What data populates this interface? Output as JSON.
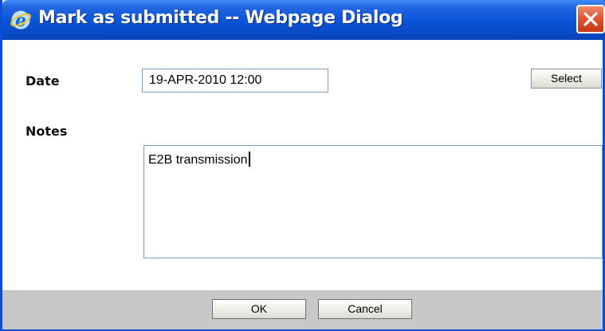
{
  "window": {
    "title": "Mark as submitted -- Webpage Dialog",
    "title_icon": "internet-explorer-icon",
    "close_icon": "close-icon",
    "colors": {
      "titlebar": "#0a55d8",
      "close_button": "#e0512a",
      "footer": "#c8c8c8"
    }
  },
  "form": {
    "date_label": "Date",
    "date_value": "19-APR-2010 12:00",
    "select_label": "Select",
    "notes_label": "Notes",
    "notes_value": "E2B transmission"
  },
  "footer": {
    "ok_label": "OK",
    "cancel_label": "Cancel"
  }
}
